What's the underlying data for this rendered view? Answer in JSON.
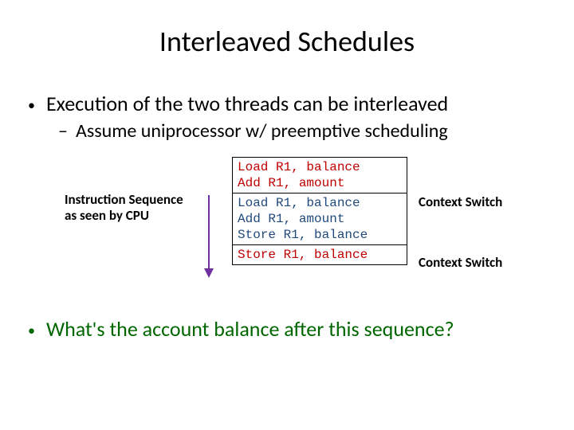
{
  "title": "Interleaved Schedules",
  "bullet1": "Execution of the two threads can be interleaved",
  "bullet2": "Assume uniprocessor w/ preemptive scheduling",
  "leftAnnot": "Instruction Sequence as seen by CPU",
  "code": {
    "box1": {
      "l1": "Load  R1, balance",
      "l2": "Add   R1, amount"
    },
    "box2": {
      "l1": "Load  R1, balance",
      "l2": "Add   R1, amount",
      "l3": "Store R1, balance"
    },
    "box3": {
      "l1": "Store R1, balance"
    }
  },
  "rightAnnot1": "Context Switch",
  "rightAnnot2": "Context Switch",
  "bullet3": "What's the account balance after this sequence?"
}
